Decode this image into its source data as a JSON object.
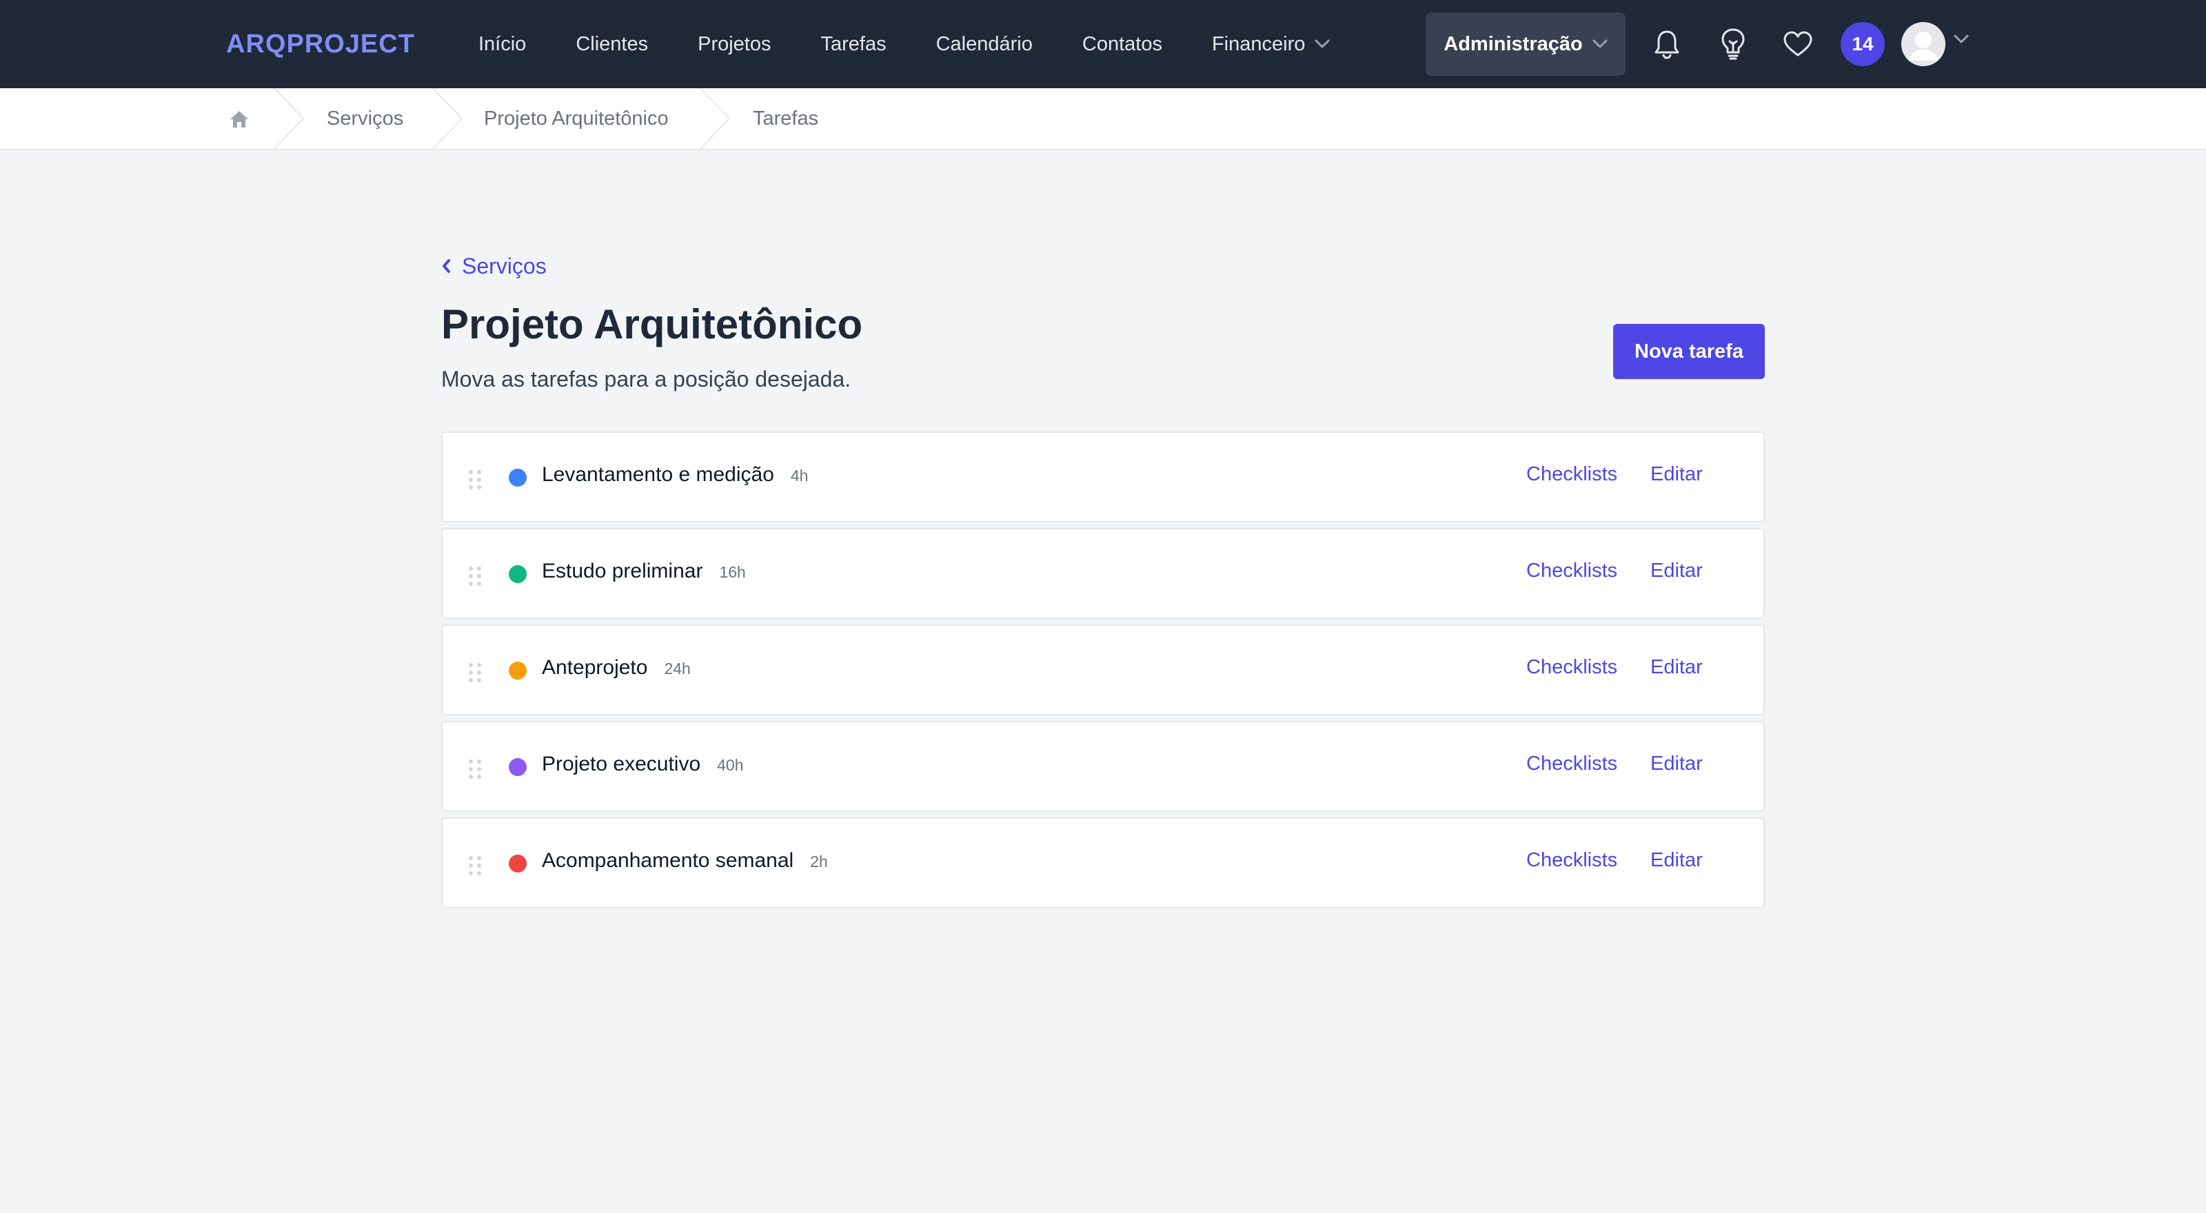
{
  "brand": {
    "logo_text": "ARQPROJECT",
    "accent": "#4f46e5"
  },
  "nav": {
    "links": [
      {
        "label": "Início"
      },
      {
        "label": "Clientes"
      },
      {
        "label": "Projetos"
      },
      {
        "label": "Tarefas"
      },
      {
        "label": "Calendário"
      },
      {
        "label": "Contatos"
      },
      {
        "label": "Financeiro",
        "dropdown": true
      }
    ],
    "admin_label": "Administração",
    "notification_count": "14",
    "icons": [
      "bell-icon",
      "lightbulb-icon",
      "heart-icon",
      "user-avatar"
    ]
  },
  "breadcrumb": {
    "items": [
      "Serviços",
      "Projeto Arquitetônico",
      "Tarefas"
    ]
  },
  "page": {
    "back_label": "Serviços",
    "title": "Projeto Arquitetônico",
    "subtitle": "Mova as tarefas para a posição desejada.",
    "new_task_label": "Nova tarefa"
  },
  "tasks": [
    {
      "name": "Levantamento e medição",
      "hours": "4h",
      "color": "#3b82f6",
      "checklists_label": "Checklists",
      "edit_label": "Editar"
    },
    {
      "name": "Estudo preliminar",
      "hours": "16h",
      "color": "#10b981",
      "checklists_label": "Checklists",
      "edit_label": "Editar"
    },
    {
      "name": "Anteprojeto",
      "hours": "24h",
      "color": "#f59e0b",
      "checklists_label": "Checklists",
      "edit_label": "Editar"
    },
    {
      "name": "Projeto executivo",
      "hours": "40h",
      "color": "#8b5cf6",
      "checklists_label": "Checklists",
      "edit_label": "Editar"
    },
    {
      "name": "Acompanhamento semanal",
      "hours": "2h",
      "color": "#ef4444",
      "checklists_label": "Checklists",
      "edit_label": "Editar"
    }
  ]
}
